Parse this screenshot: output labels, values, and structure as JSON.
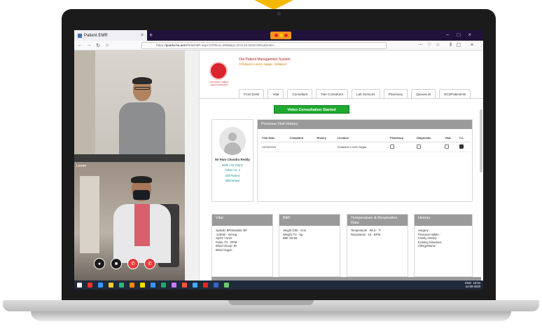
{
  "browser": {
    "tab_title": "Patient EMR",
    "url_prefix": "https://",
    "url_domain": "quarta-ha.aem",
    "url_path": "/TeleEMR.aspx?OPDno=2068&pt=GHC16-0818-0001&trnID=..."
  },
  "video": {
    "label": "Lorem"
  },
  "app": {
    "title": "Out Patient Management System",
    "subtitle": "Chhatarni Lorem Nagar, Vellabod",
    "logo_text": "NATIONAL URBAN HEALTH MISSION",
    "tabs": [
      "Front Desk",
      "Vital",
      "Consultant",
      "Tele Consultant",
      "Lab Services",
      "Pharmacy",
      "QueueList",
      "NCDPatientHis"
    ],
    "video_button": "Video Consultation Started",
    "patient": {
      "name": "Mr Ram Chandra Reddy",
      "info1": "Male / 62 Years/",
      "info2": "Token no: 3",
      "info3": "Old Patient",
      "info4": "Vatsrampur"
    },
    "visit_history": {
      "title": "Previous Visit History",
      "columns": [
        "Visit Date",
        "Complaint",
        "History",
        "Location",
        "Pharmacy",
        "Diagnostic",
        "Vital",
        "T.C."
      ],
      "rows": [
        {
          "date": "14/09/2020",
          "complaint": "",
          "history": "",
          "location": "Chhatarni Lorem Nagar"
        }
      ]
    },
    "vital_card": {
      "title": "Vital",
      "lines": [
        "Systolic BP/Diastolic BP",
        ":120/80 - mmHg",
        "SpO2 / RAN",
        "Pulse /72 - BPM",
        "Blood Group :B+",
        "Blood Sugar :"
      ]
    },
    "bmi_card": {
      "title": "BMI",
      "lines": [
        "Height /155 - cms",
        "Weight /71 - kg",
        "BMI /29.55"
      ]
    },
    "temp_card": {
      "title": "Temperature & Respiration Rate",
      "lines": [
        "Temperature : 98.6 - °F",
        "Respiration : 16 - BPM"
      ]
    },
    "history_card": {
      "title": "History",
      "lines": [
        "Surgery :",
        "Personal Habits :",
        "Family History :",
        "Existing Diseases :",
        "Allergy/Name :"
      ]
    }
  },
  "taskbar": {
    "time": "15:04",
    "date": "14-09-2020",
    "lang": "ENG"
  },
  "colors": {
    "accent_green": "#1eaa2e",
    "brand_red": "#d9252b",
    "header_grey": "#9a9a9a"
  }
}
